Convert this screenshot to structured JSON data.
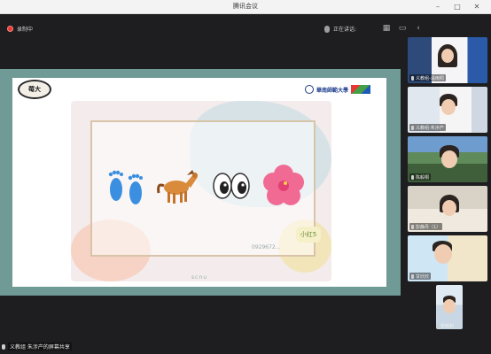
{
  "window": {
    "title": "腾讯会议"
  },
  "topbar": {
    "recording_label": "录制中",
    "speaking_label": "正在讲话:"
  },
  "slide": {
    "logo_text": "莓大",
    "university_name": "華南師範大學",
    "footer_text": "scnu",
    "badge_text": "小红5",
    "watermark_text": "0929672..."
  },
  "participants": [
    {
      "name": "义教组-温雨桐"
    },
    {
      "name": "义教组-朱涉产"
    },
    {
      "name": "陈毅桐"
    },
    {
      "name": "彭静丹（1）"
    },
    {
      "name": "甘欣欣"
    },
    {
      "name": "李晓莉"
    }
  ],
  "status": {
    "share_label": "义教组 朱涉产的屏幕共享"
  },
  "colors": {
    "share_bg": "#6f9a96",
    "recording": "#e53935",
    "app_bg": "#1e1e21"
  }
}
